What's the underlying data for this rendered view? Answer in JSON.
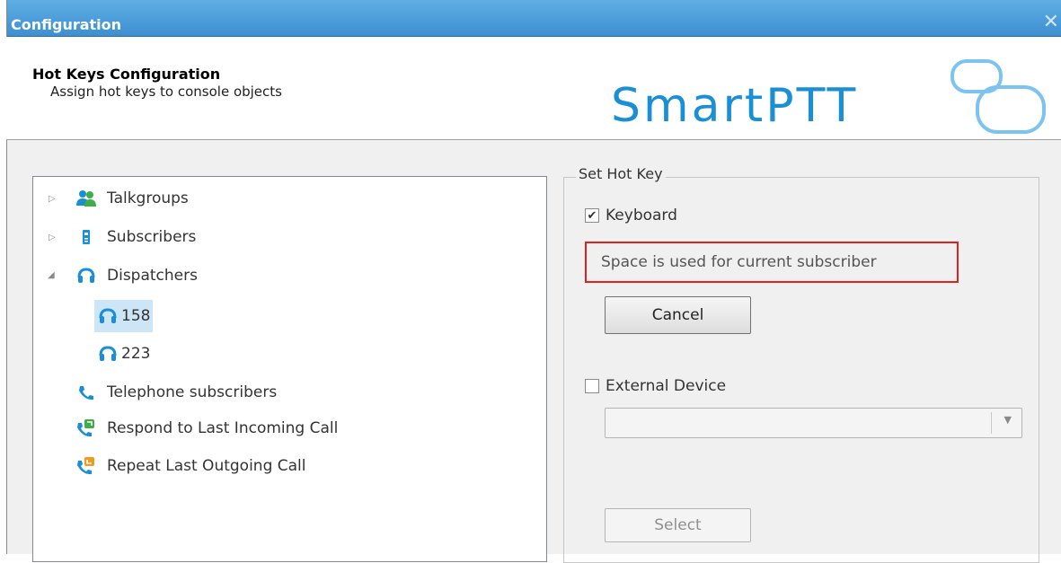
{
  "window": {
    "title": "Configuration",
    "close_glyph": "✕"
  },
  "header": {
    "title": "Hot Keys Configuration",
    "subtitle": "Assign hot keys to console objects",
    "logo_text": "SmartPTT"
  },
  "tree": {
    "items": [
      {
        "label": "Talkgroups",
        "icon": "talkgroups-icon",
        "expander": "▷"
      },
      {
        "label": "Subscribers",
        "icon": "radio-icon",
        "expander": "▷"
      },
      {
        "label": "Dispatchers",
        "icon": "headset-icon",
        "expander": "◢"
      },
      {
        "label": "158",
        "icon": "headset-icon",
        "selected": true
      },
      {
        "label": "223",
        "icon": "headset-icon"
      },
      {
        "label": "Telephone subscribers",
        "icon": "phone-icon"
      },
      {
        "label": "Respond to Last Incoming Call",
        "icon": "incoming-call-icon"
      },
      {
        "label": "Repeat Last Outgoing Call",
        "icon": "outgoing-call-icon"
      }
    ]
  },
  "hotkey": {
    "group_label": "Set Hot Key",
    "keyboard_label": "Keyboard",
    "keyboard_checked": true,
    "message": "Space is used for current subscriber",
    "cancel_label": "Cancel",
    "external_label": "External Device",
    "external_checked": false,
    "device_value": "",
    "select_label": "Select"
  },
  "colors": {
    "titlebar": "#4a9cdc",
    "highlight_border": "#e0201a",
    "selection": "#cde6f7",
    "icon_blue": "#1a8fd6",
    "icon_green": "#3fae49",
    "icon_orange": "#f39a1e"
  }
}
